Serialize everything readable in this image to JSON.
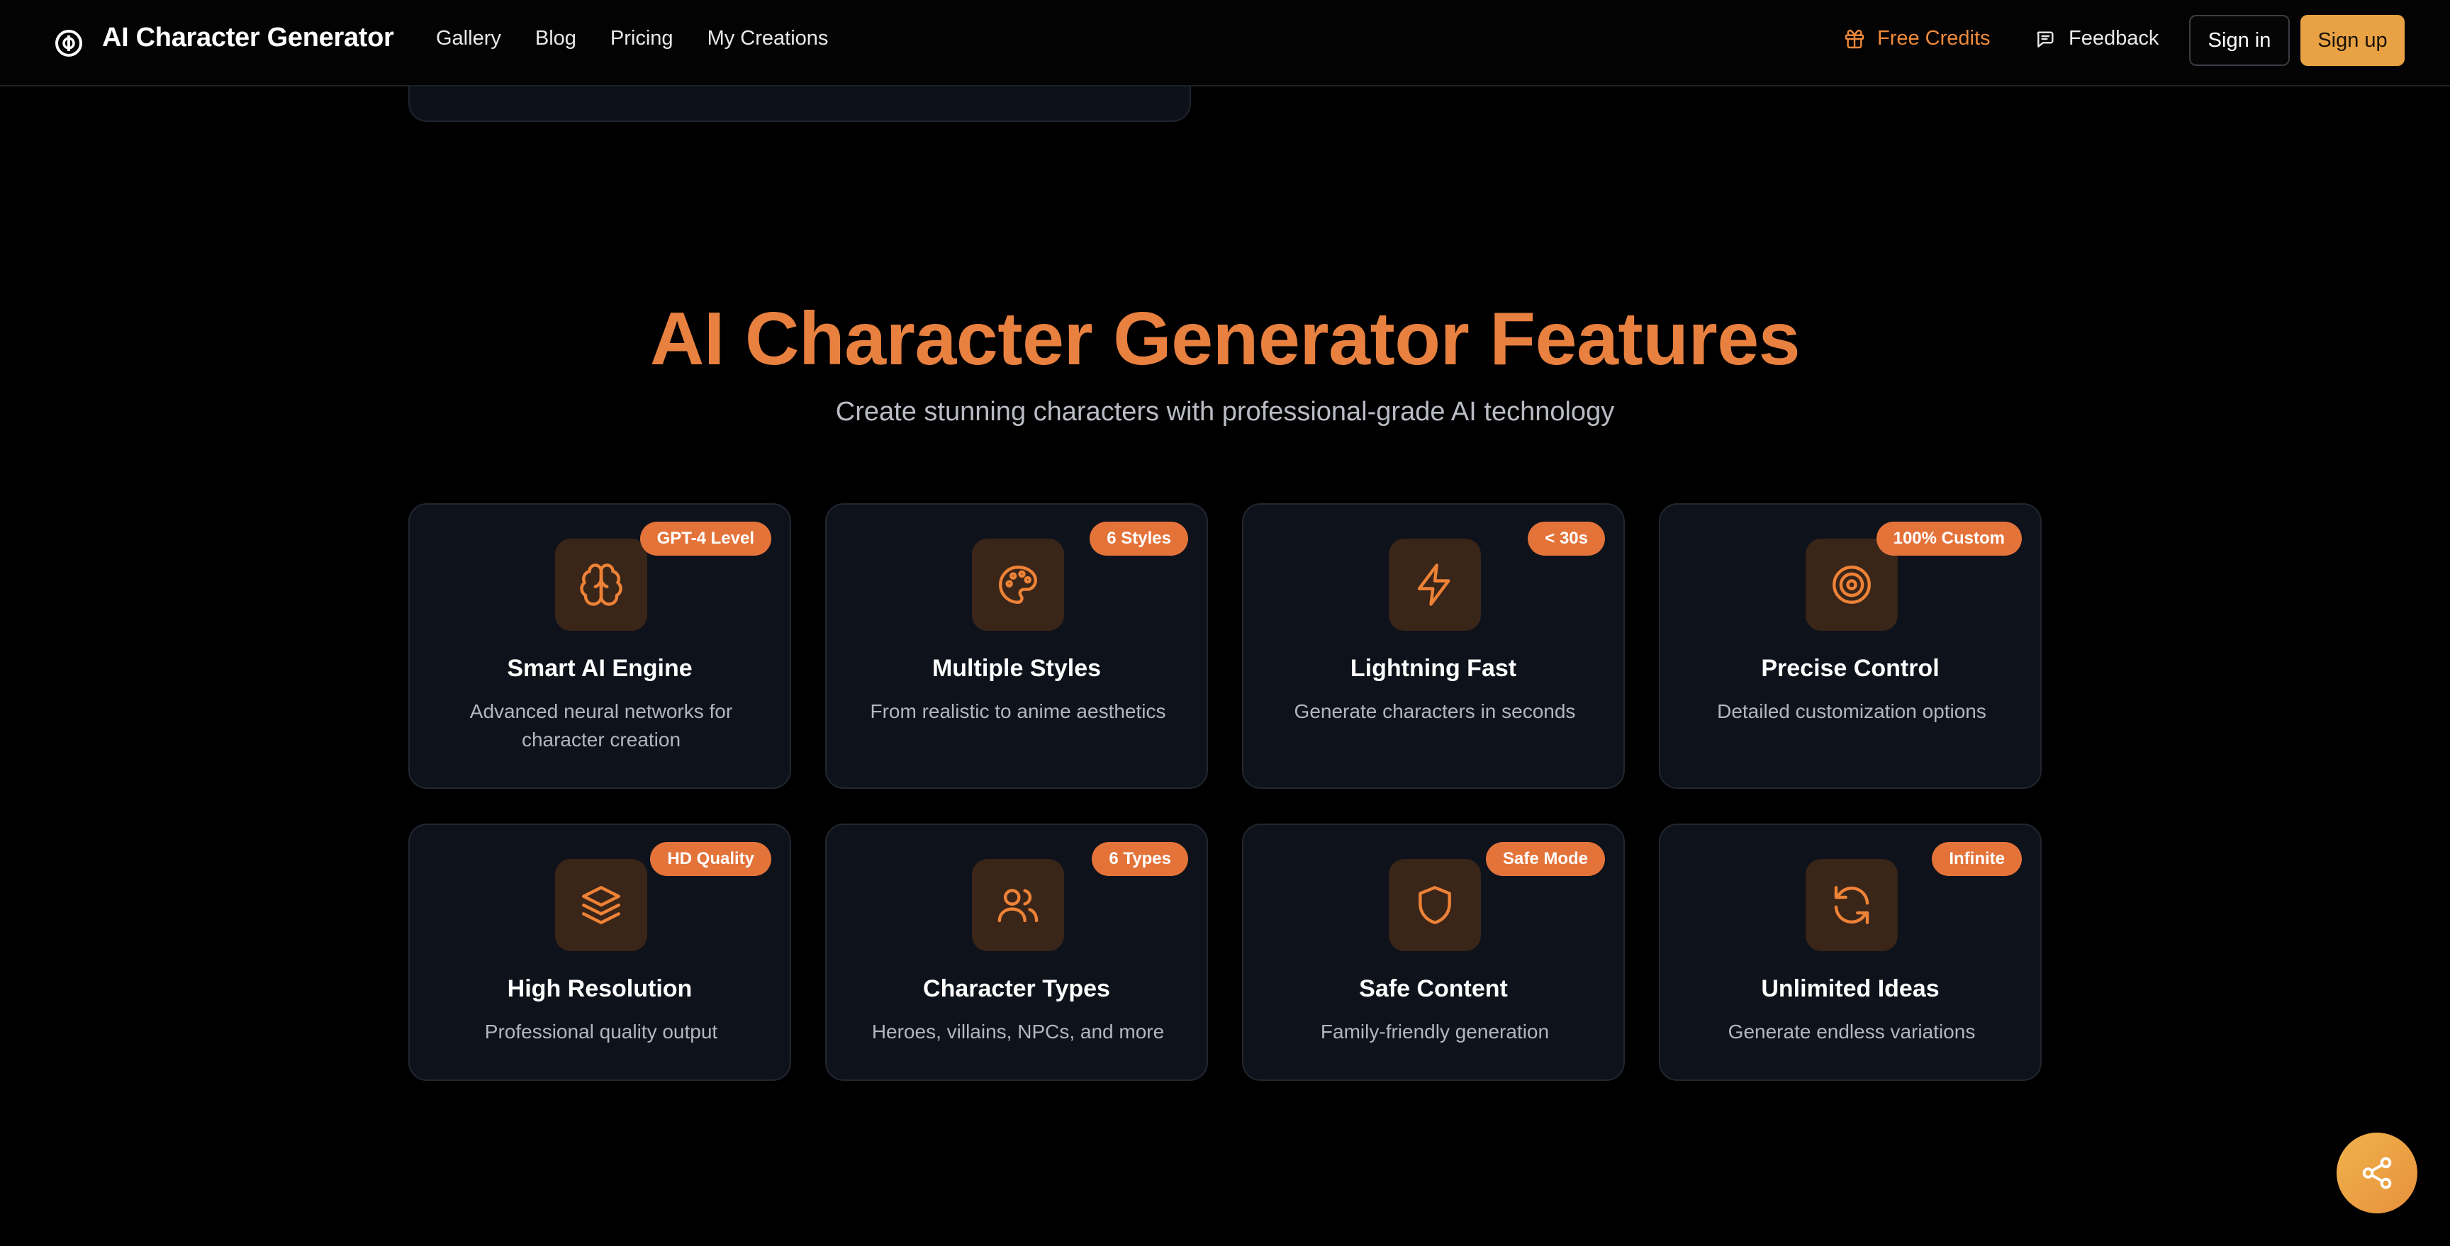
{
  "header": {
    "brand": "AI Character Generator",
    "nav": [
      "Gallery",
      "Blog",
      "Pricing",
      "My Creations"
    ],
    "free_credits": "Free Credits",
    "feedback": "Feedback",
    "sign_in": "Sign in",
    "sign_up": "Sign up"
  },
  "features": {
    "title": "AI Character Generator Features",
    "subtitle": "Create stunning characters with professional-grade AI technology",
    "cards": [
      {
        "icon": "brain-icon",
        "badge": "GPT-4 Level",
        "title": "Smart AI Engine",
        "desc": "Advanced neural networks for character creation"
      },
      {
        "icon": "palette-icon",
        "badge": "6 Styles",
        "title": "Multiple Styles",
        "desc": "From realistic to anime aesthetics"
      },
      {
        "icon": "lightning-icon",
        "badge": "< 30s",
        "title": "Lightning Fast",
        "desc": "Generate characters in seconds"
      },
      {
        "icon": "target-icon",
        "badge": "100% Custom",
        "title": "Precise Control",
        "desc": "Detailed customization options"
      },
      {
        "icon": "layers-icon",
        "badge": "HD Quality",
        "title": "High Resolution",
        "desc": "Professional quality output"
      },
      {
        "icon": "users-icon",
        "badge": "6 Types",
        "title": "Character Types",
        "desc": "Heroes, villains, NPCs, and more"
      },
      {
        "icon": "shield-icon",
        "badge": "Safe Mode",
        "title": "Safe Content",
        "desc": "Family-friendly generation"
      },
      {
        "icon": "refresh-icon",
        "badge": "Infinite",
        "title": "Unlimited Ideas",
        "desc": "Generate endless variations"
      }
    ]
  },
  "colors": {
    "accent": "#e8803f",
    "badge": "#e4733a",
    "signup": "#e9a243",
    "card_bg": "#0e121b"
  }
}
